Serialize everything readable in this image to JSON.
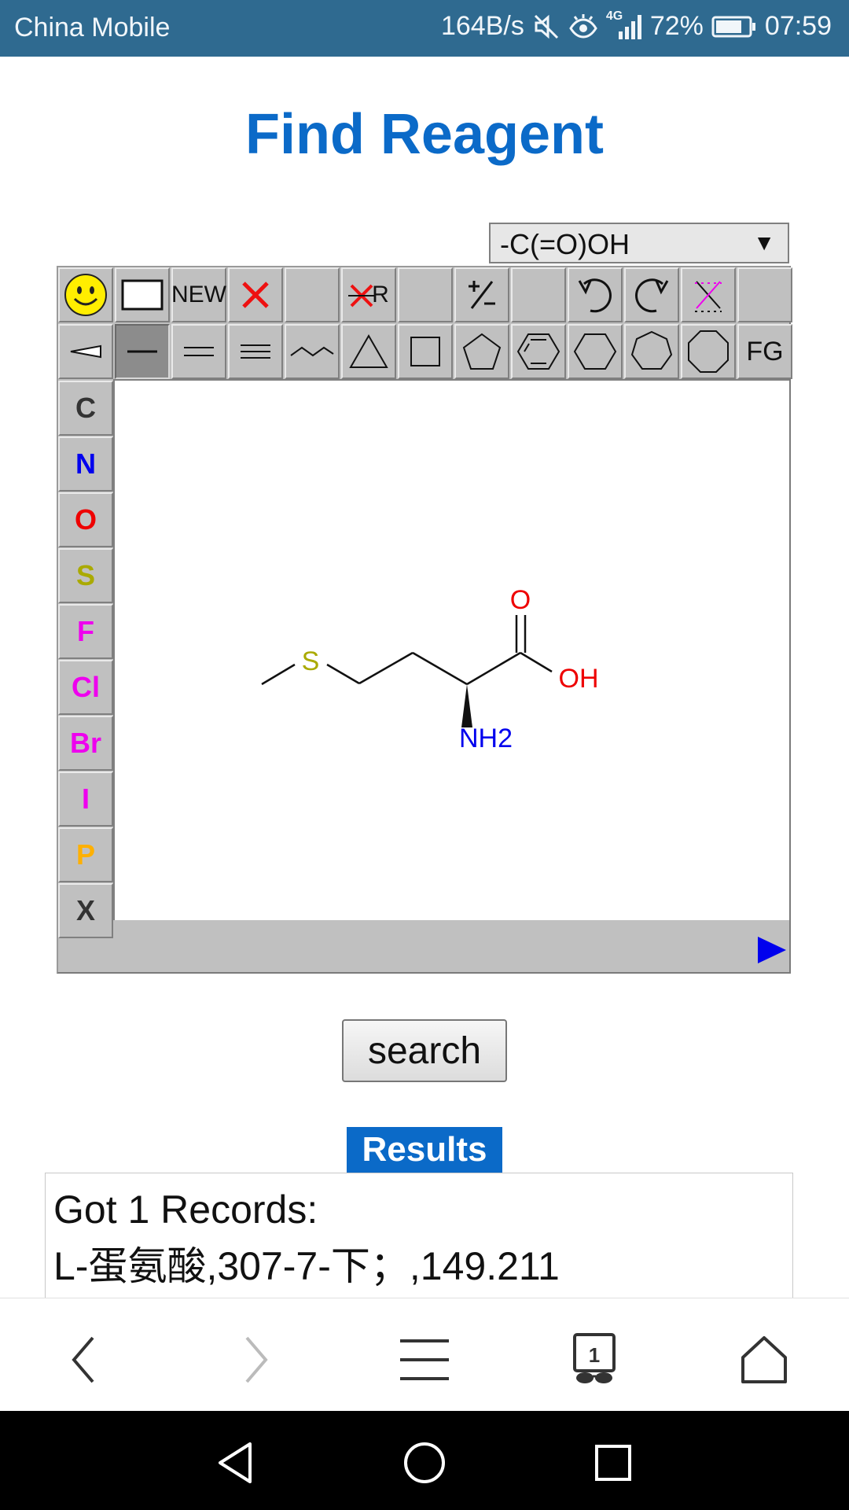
{
  "status_bar": {
    "carrier": "China Mobile",
    "net_speed": "164B/s",
    "network": "4G",
    "battery": "72%",
    "time": "07:59"
  },
  "page": {
    "title": "Find Reagent"
  },
  "editor": {
    "functional_group_select": "-C(=O)OH",
    "toolbar_row1": {
      "new_label": "NEW",
      "rgroup_label": "R"
    },
    "toolbar_row2": {
      "fg_label": "FG"
    },
    "elements": [
      "C",
      "N",
      "O",
      "S",
      "F",
      "Cl",
      "Br",
      "I",
      "P",
      "X"
    ],
    "element_colors": {
      "C": "#333333",
      "N": "#0000ee",
      "O": "#ee0000",
      "S": "#aaaa00",
      "F": "#ee00ee",
      "Cl": "#ee00ee",
      "Br": "#ee00ee",
      "I": "#ee00ee",
      "P": "#ffb000",
      "X": "#333333"
    },
    "molecule": {
      "sulfur": "S",
      "oxygen": "O",
      "hydroxyl": "OH",
      "amine": "NH2"
    }
  },
  "search": {
    "button_label": "search"
  },
  "results": {
    "label": "Results",
    "summary": "Got 1 Records:",
    "record": "L-蛋氨酸,307-7-下；,149.211"
  },
  "browser_nav": {
    "tab_count": "1"
  }
}
